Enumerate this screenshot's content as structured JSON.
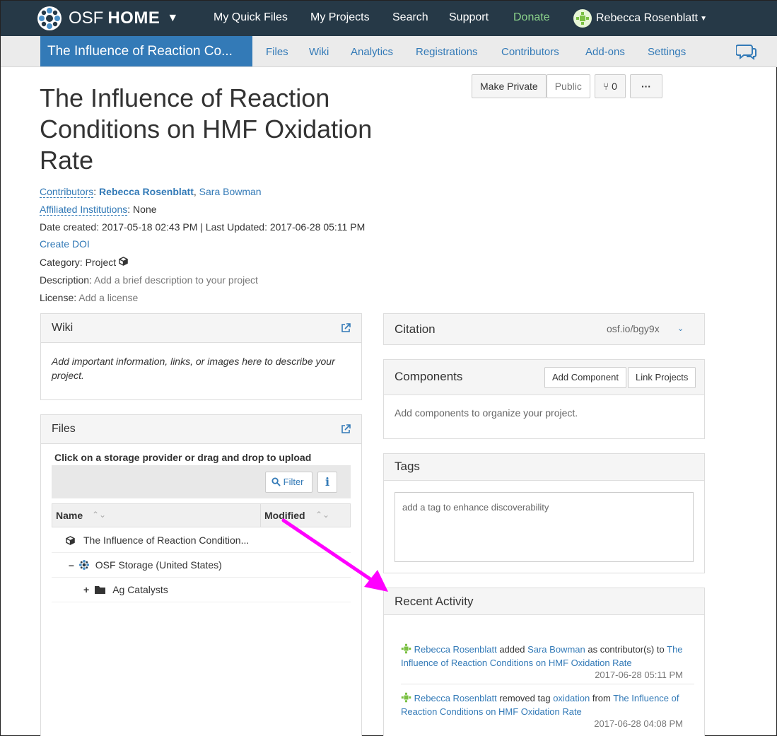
{
  "topnav": {
    "brand_prefix": "OSF",
    "brand_bold": "HOME",
    "links": [
      "My Quick Files",
      "My Projects",
      "Search",
      "Support"
    ],
    "donate": "Donate",
    "user_name": "Rebecca Rosenblatt"
  },
  "subnav": {
    "project_short": "The Influence of Reaction Co...",
    "links": [
      "Files",
      "Wiki",
      "Analytics",
      "Registrations",
      "Contributors",
      "Add-ons",
      "Settings"
    ]
  },
  "project": {
    "title": "The Influence of Reaction Conditions on HMF Oxidation Rate",
    "make_private": "Make Private",
    "public": "Public",
    "fork_count": "0",
    "more": "···",
    "contributors_label": "Contributors",
    "contributor1": "Rebecca Rosenblatt",
    "contributor2": "Sara Bowman",
    "affiliated_label": "Affiliated Institutions",
    "affiliated_value": "None",
    "dates": "Date created: 2017-05-18 02:43 PM | Last Updated: 2017-06-28 05:11 PM",
    "create_doi": "Create DOI",
    "category_label": "Category:",
    "category_value": "Project",
    "description_label": "Description:",
    "description_value": "Add a brief description to your project",
    "license_label": "License:",
    "license_value": "Add a license"
  },
  "wiki": {
    "title": "Wiki",
    "body": "Add important information, links, or images here to describe your project."
  },
  "files": {
    "title": "Files",
    "hint": "Click on a storage provider or drag and drop to upload",
    "filter": "Filter",
    "col_name": "Name",
    "col_modified": "Modified",
    "rows": [
      "The Influence of Reaction Condition...",
      "OSF Storage (United States)",
      "Ag Catalysts"
    ]
  },
  "citation": {
    "title": "Citation",
    "url": "osf.io/bgy9x"
  },
  "components": {
    "title": "Components",
    "add": "Add Component",
    "link": "Link Projects",
    "body": "Add components to organize your project."
  },
  "tags": {
    "title": "Tags",
    "placeholder": "add a tag to enhance discoverability"
  },
  "activity": {
    "title": "Recent Activity",
    "items": [
      {
        "user": "Rebecca Rosenblatt",
        "verb": " added ",
        "target": "Sara Bowman",
        "mid": " as contributor(s) to",
        "project": "The Influence of Reaction Conditions on HMF Oxidation Rate",
        "date": "2017-06-28 05:11 PM"
      },
      {
        "user": "Rebecca Rosenblatt",
        "verb": " removed tag ",
        "target": "oxidation",
        "mid": " from ",
        "project": "The Influence of Reaction Conditions on HMF Oxidation Rate",
        "date": "2017-06-28 04:08 PM"
      }
    ]
  },
  "colors": {
    "nav_bg": "#263947",
    "accent": "#337ab7",
    "annotation_arrow": "#ff00ff"
  }
}
